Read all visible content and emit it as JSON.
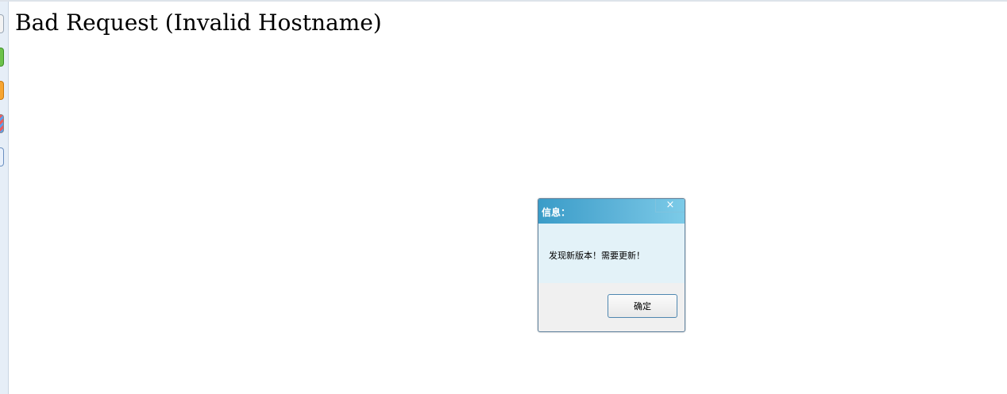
{
  "page": {
    "error_text": "Bad Request (Invalid Hostname)"
  },
  "left_strip": {
    "icons": [
      "page-icon",
      "green-icon",
      "orange-icon",
      "striped-icon",
      "blue-icon"
    ]
  },
  "dialog": {
    "title": "信息：",
    "close_glyph": "×",
    "message": "发现新版本！需要更新！",
    "ok_label": "确定"
  },
  "colors": {
    "titlebar_start": "#3a9cc8",
    "titlebar_end": "#7ccbe8",
    "body_background": "#e3f2f8",
    "button_border": "#4f87b0"
  }
}
